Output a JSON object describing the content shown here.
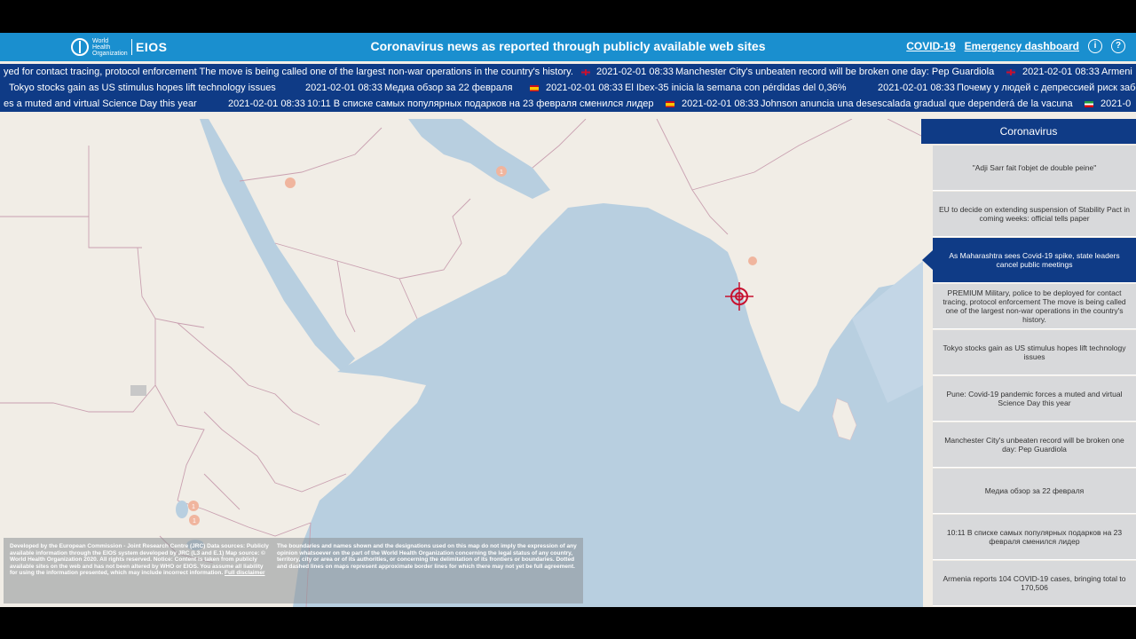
{
  "header": {
    "logo_org": "World Health Organization",
    "logo_name": "EIOS",
    "title": "Coronavirus news as reported through publicly available web sites",
    "link_covid": "COVID-19",
    "link_dashboard": "Emergency dashboard",
    "info_icon": "info-icon",
    "help_icon": "help-icon"
  },
  "tickers": {
    "row1": {
      "a": "yed for contact tracing, protocol enforcement The move is being called one of the largest non-war operations in the country's history.",
      "b_time": "2021-02-01 08:33",
      "b_text": "Manchester City's unbeaten record will be broken one day: Pep Guardiola",
      "c_time": "2021-02-01 08:33",
      "c_text": "Armeni"
    },
    "row2": {
      "a": "Tokyo stocks gain as US stimulus hopes lift technology issues",
      "b_time": "2021-02-01 08:33",
      "b_text": "Медиа обзор за 22 февраля",
      "c_time": "2021-02-01 08:33",
      "c_text": "El Ibex-35 inicia la semana con pérdidas del 0,36%",
      "d_time": "2021-02-01 08:33",
      "d_text": "Почему у людей с депрессией риск забо"
    },
    "row3": {
      "a": "es a muted and virtual Science Day this year",
      "b_time": "2021-02-01 08:33",
      "b_text": "10:11 В списке самых популярных подарков на 23 февраля сменился лидер",
      "c_time": "2021-02-01 08:33",
      "c_text": "Johnson anuncia una desescalada gradual que dependerá de la vacuna",
      "d_time": "2021-0"
    }
  },
  "map": {
    "cluster_count": "1"
  },
  "panel": {
    "title": "Coronavirus",
    "items": [
      "\"Adji Sarr fait l'objet de double peine\"",
      "EU to decide on extending suspension of Stability Pact in coming weeks: official tells paper",
      "As Maharashtra sees Covid-19 spike, state leaders cancel public meetings",
      "PREMIUM Military, police to be deployed for contact tracing, protocol enforcement The move is being called one of the largest non-war operations in the country's history.",
      "Tokyo stocks gain as US stimulus hopes lift technology issues",
      "Pune: Covid-19 pandemic forces a muted and virtual Science Day this year",
      "Manchester City's unbeaten record will be broken one day: Pep Guardiola",
      "Медиа обзор за 22 февраля",
      "10:11 В списке самых популярных подарков на 23 февраля сменился лидер",
      "Armenia reports 104 COVID-19 cases, bringing total to 170,506"
    ],
    "active_index": 2
  },
  "disclaimer": {
    "left": "Developed by the European Commission - Joint Research Centre (JRC) Data sources: Publicly available information through the EIOS system developed by JRC (L3 and E.1) Map source: © World Health Organization 2020. All rights reserved. Notice: Content is taken from publicly available sites on the web and has not been altered by WHO or EIOS. You assume all liability for using the information presented, which may include incorrect information.",
    "link": "Full disclaimer",
    "right": "The boundaries and names shown and the designations used on this map do not imply the expression of any opinion whatsoever on the part of the World Health Organization concerning the legal status of any country, territory, city or area or of its authorities, or concerning the delimitation of its frontiers or boundaries. Dotted and dashed lines on maps represent approximate border lines for which there may not yet be full agreement."
  },
  "colors": {
    "header": "#1a8fcf",
    "ticker": "#0f3b86",
    "sea": "#b8cfe0",
    "land": "#f1ede6",
    "marker": "#c8102e"
  }
}
